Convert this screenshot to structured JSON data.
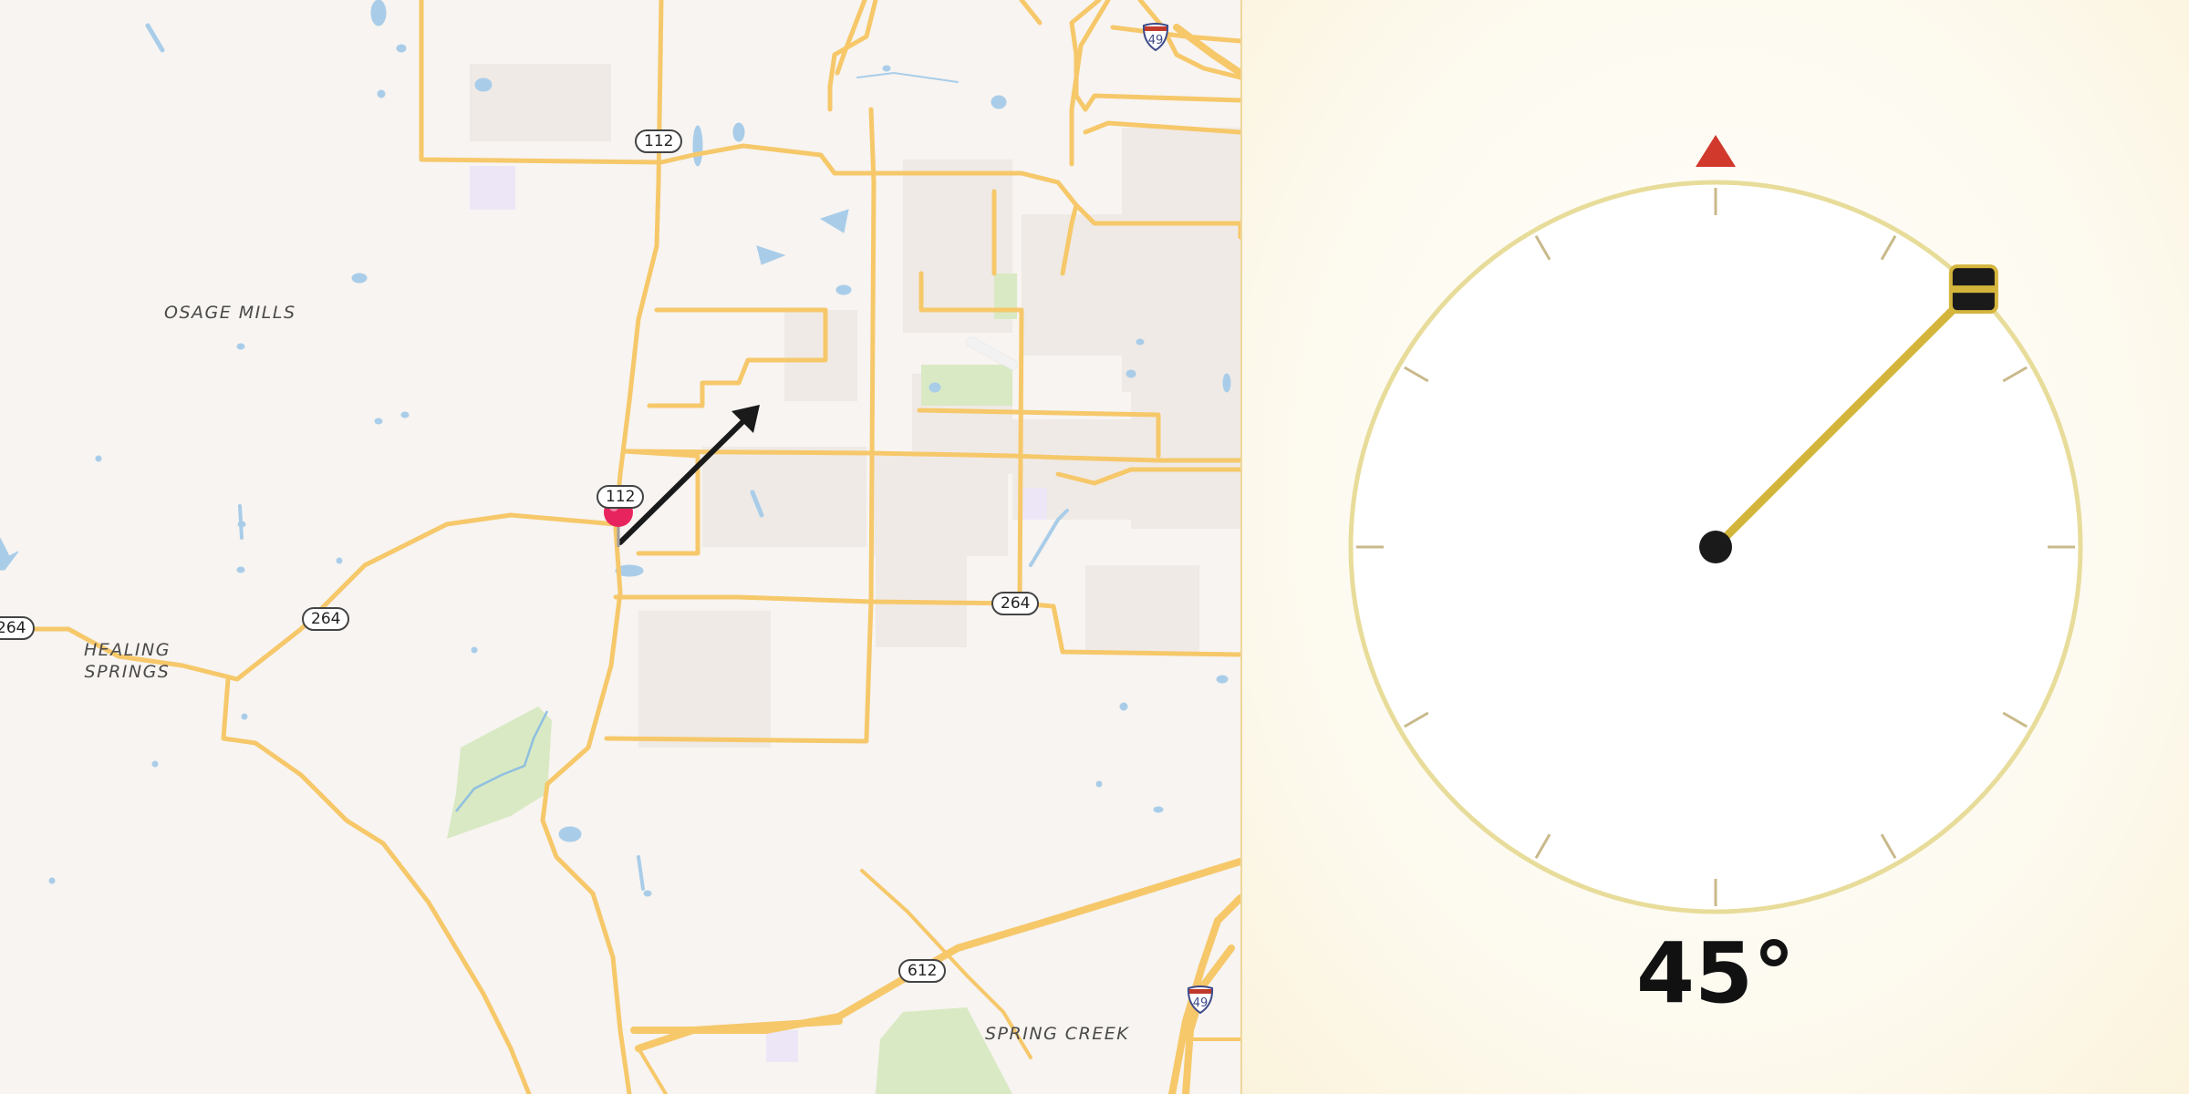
{
  "map": {
    "places": [
      {
        "id": "osage-mills",
        "name": "OSAGE MILLS"
      },
      {
        "id": "healing-springs",
        "name": "HEALING\nSPRINGS"
      },
      {
        "id": "spring-creek",
        "name": "SPRING CREEK"
      }
    ],
    "routes": [
      {
        "id": "112-north",
        "label": "112"
      },
      {
        "id": "112-center",
        "label": "112"
      },
      {
        "id": "264-west",
        "label": "264"
      },
      {
        "id": "264-edge",
        "label": "264"
      },
      {
        "id": "264-east",
        "label": "264"
      },
      {
        "id": "612",
        "label": "612"
      }
    ],
    "interstates": [
      {
        "id": "i49-north",
        "label": "49"
      },
      {
        "id": "i49-south",
        "label": "49"
      }
    ],
    "colors": {
      "background": "#f7f4f1",
      "road": "#f6c86a",
      "water": "#a9cde9",
      "park": "#d9e9c4",
      "pin": "#e8245e"
    },
    "marker": {
      "icon": "map-pin-icon"
    },
    "direction_arrow": {
      "icon": "direction-arrow-icon",
      "heading_deg": 45
    }
  },
  "compass": {
    "heading_deg": 45,
    "heading_text": "45°",
    "north_marker_icon": "north-triangle-icon",
    "handle_icon": "drag-handle-icon",
    "colors": {
      "ring": "#e8dc9a",
      "needle": "#d4b53c",
      "north": "#d0392b",
      "hub": "#1a1a1a"
    }
  }
}
